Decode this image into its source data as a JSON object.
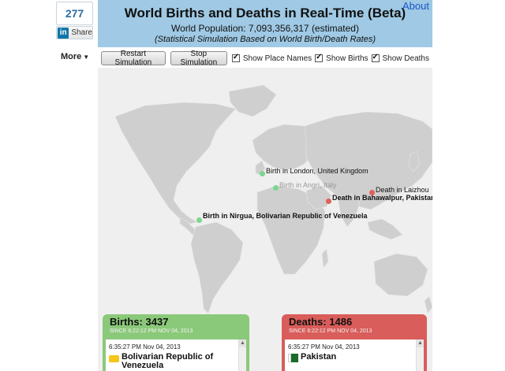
{
  "share": {
    "count": "277",
    "label": "Share",
    "logo": "in"
  },
  "more_menu": {
    "label": "More",
    "caret": "▼"
  },
  "header": {
    "title": "World Births and Deaths in Real-Time (Beta)",
    "population": "World Population: 7,093,356,317 (estimated)",
    "subtitle": "(Statistical Simulation Based on World Birth/Death Rates)",
    "background": "#9fc9e4"
  },
  "about_link": "About",
  "toolbar": {
    "restart_label": "Restart Simulation",
    "stop_label": "Stop Simulation",
    "show_place_names": "Show Place Names",
    "show_births": "Show Births",
    "show_deaths": "Show Deaths"
  },
  "map": {
    "land_color": "#cfcfcf",
    "ocean_color": "#efefef",
    "places": [
      {
        "label": "Birth in London, United Kingdom",
        "type": "birth"
      },
      {
        "label": "Birth in Angri, Italy",
        "type": "birth"
      },
      {
        "label": "Death in Bahawalpur, Pakistan",
        "type": "death"
      },
      {
        "label": "Death in Laizhou",
        "type": "death"
      },
      {
        "label": "Birth in Nirgua, Bolivarian Republic of Venezuela",
        "type": "birth"
      }
    ]
  },
  "births_panel": {
    "title": "Births: 3437",
    "since": "SINCE 6:22:12 PM NOV 04, 2013",
    "entry_time": "6:35:27 PM Nov 04, 2013",
    "entry_place_line1": "Bolivarian Republic of",
    "entry_place_line2": "Venezuela",
    "color": "#8bc97a"
  },
  "deaths_panel": {
    "title": "Deaths: 1486",
    "since": "SINCE 6:22:12 PM NOV 04, 2013",
    "entry_time": "6:35:27 PM Nov 04, 2013",
    "entry_place": "Pakistan",
    "color": "#d95d5a"
  },
  "icons": {
    "scroll_up": "▲"
  }
}
